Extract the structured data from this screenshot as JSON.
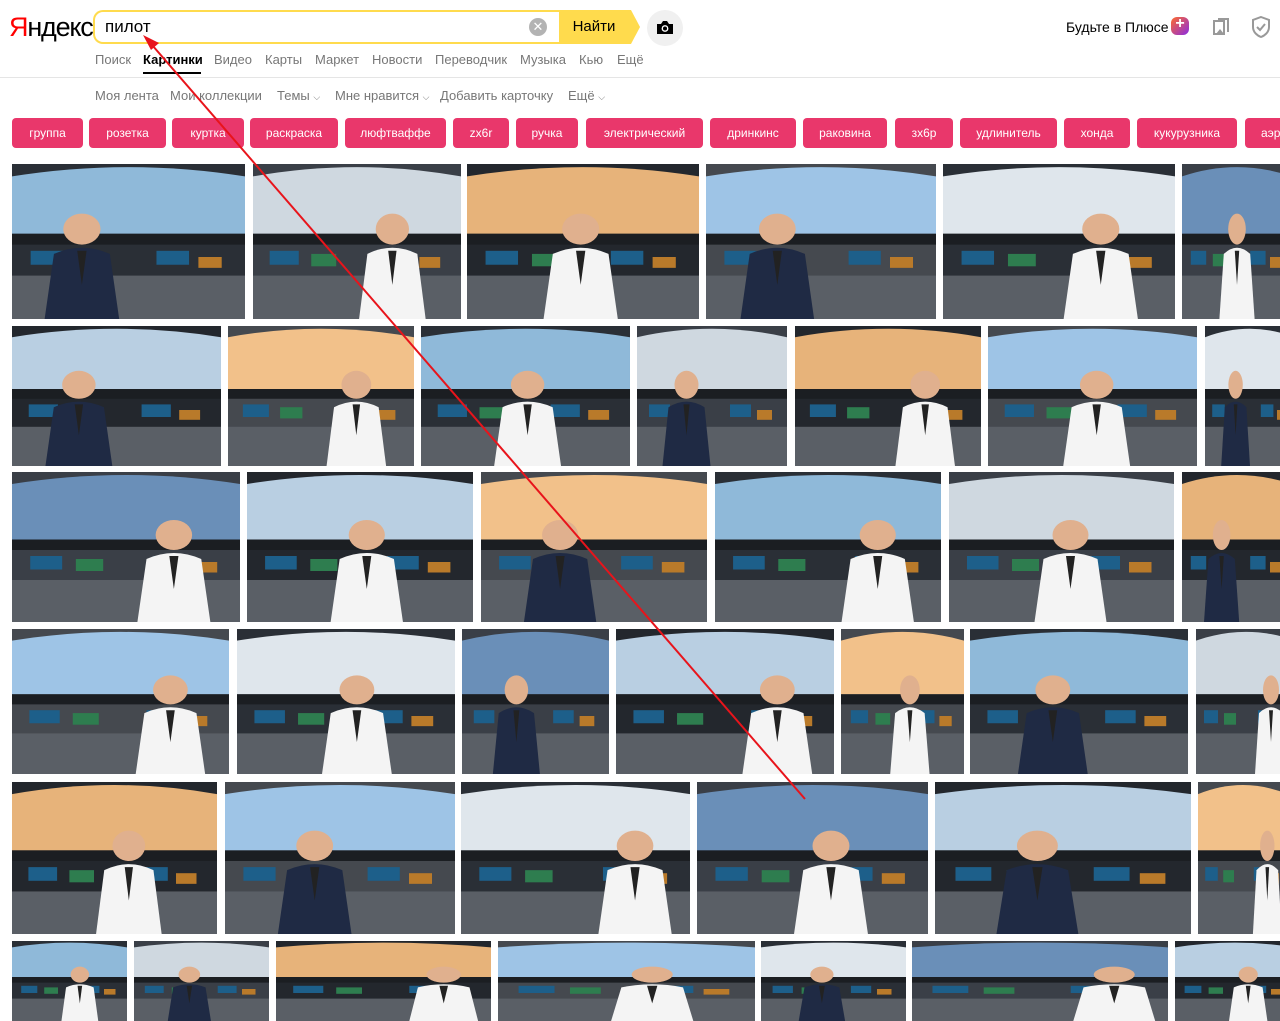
{
  "header": {
    "logo_first": "Я",
    "logo_rest": "ндекс",
    "search_value": "пилот",
    "find_label": "Найти",
    "plus_label": "Будьте в Плюсе",
    "plus_badge": "+"
  },
  "nav": {
    "tabs": [
      "Поиск",
      "Картинки",
      "Видео",
      "Карты",
      "Маркет",
      "Новости",
      "Переводчик",
      "Музыка",
      "Кью",
      "Ещё"
    ],
    "active": "Картинки"
  },
  "subnav": [
    "Моя лента",
    "Мои коллекции",
    "Темы",
    "Мне нравится",
    "Добавить карточку",
    "Ещё"
  ],
  "chips": [
    "группа",
    "розетка",
    "куртка",
    "раскраска",
    "люфтваффе",
    "zx6r",
    "ручка",
    "электрический",
    "дринкинс",
    "раковина",
    "зх6р",
    "удлинитель",
    "хонда",
    "кукурузника",
    "аэр"
  ],
  "colors": {
    "accent": "#ffdb4d",
    "chip": "#e9376b",
    "annotation": "#e8141b"
  },
  "icons": {
    "camera": "camera-icon",
    "clear": "clear-icon",
    "collections": "collections-icon",
    "shield": "shield-icon"
  }
}
